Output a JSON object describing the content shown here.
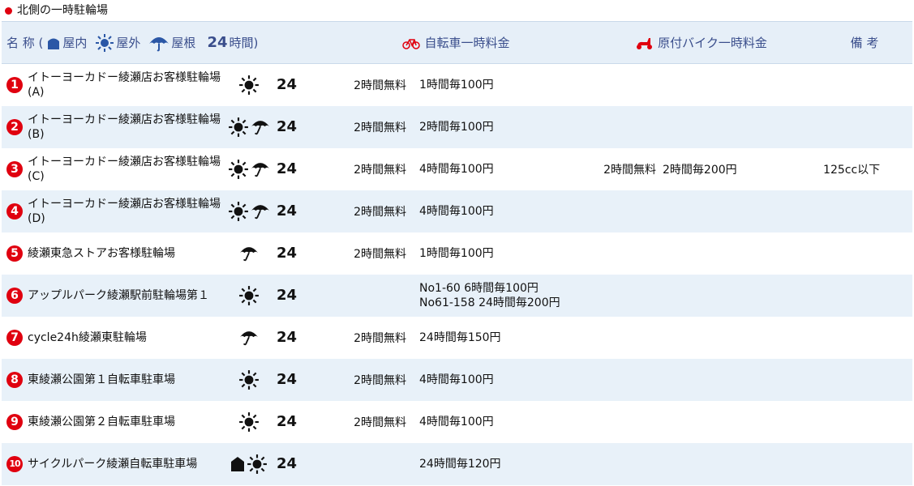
{
  "section": {
    "title": "北側の一時駐輪場"
  },
  "header": {
    "name_label": "名 称 (",
    "indoor_label": "屋内",
    "outdoor_label": "屋外",
    "roof_label": "屋根",
    "h24_number": "24",
    "h24_label": "時間)",
    "bicycle_fee_label": "自転車一時料金",
    "moped_fee_label": "原付バイク一時料金",
    "notes_label": "備 考"
  },
  "rows": [
    {
      "num": "1",
      "name": "イトーヨーカドー綾瀬店お客様駐輪場",
      "name_sub": "(A)",
      "icons": [
        "sun"
      ],
      "hours": "24",
      "bike_free": "2時間無料",
      "bike_fee": "1時間毎100円",
      "bike_fee2": "",
      "moto_free": "",
      "moto_fee": "",
      "notes": ""
    },
    {
      "num": "2",
      "name": "イトーヨーカドー綾瀬店お客様駐輪場",
      "name_sub": "(B)",
      "icons": [
        "sun",
        "umbrella"
      ],
      "hours": "24",
      "bike_free": "2時間無料",
      "bike_fee": "2時間毎100円",
      "bike_fee2": "",
      "moto_free": "",
      "moto_fee": "",
      "notes": ""
    },
    {
      "num": "3",
      "name": "イトーヨーカドー綾瀬店お客様駐輪場",
      "name_sub": "(C)",
      "icons": [
        "sun",
        "umbrella"
      ],
      "hours": "24",
      "bike_free": "2時間無料",
      "bike_fee": "4時間毎100円",
      "bike_fee2": "",
      "moto_free": "2時間無料",
      "moto_fee": "2時間毎200円",
      "notes": "125cc以下"
    },
    {
      "num": "4",
      "name": "イトーヨーカドー綾瀬店お客様駐輪場",
      "name_sub": "(D)",
      "icons": [
        "sun",
        "umbrella"
      ],
      "hours": "24",
      "bike_free": "2時間無料",
      "bike_fee": "4時間毎100円",
      "bike_fee2": "",
      "moto_free": "",
      "moto_fee": "",
      "notes": ""
    },
    {
      "num": "5",
      "name": "綾瀬東急ストアお客様駐輪場",
      "name_sub": "",
      "icons": [
        "umbrella"
      ],
      "hours": "24",
      "bike_free": "2時間無料",
      "bike_fee": "1時間毎100円",
      "bike_fee2": "",
      "moto_free": "",
      "moto_fee": "",
      "notes": ""
    },
    {
      "num": "6",
      "name": "アップルパーク綾瀬駅前駐輪場第１",
      "name_sub": "",
      "icons": [
        "sun"
      ],
      "hours": "24",
      "bike_free": "",
      "bike_fee": "No1-60 6時間毎100円",
      "bike_fee2": "No61-158 24時間毎200円",
      "moto_free": "",
      "moto_fee": "",
      "notes": ""
    },
    {
      "num": "7",
      "name": "cycle24h綾瀬東駐輪場",
      "name_sub": "",
      "icons": [
        "umbrella"
      ],
      "hours": "24",
      "bike_free": "2時間無料",
      "bike_fee": "24時間毎150円",
      "bike_fee2": "",
      "moto_free": "",
      "moto_fee": "",
      "notes": ""
    },
    {
      "num": "8",
      "name": "東綾瀬公園第１自転車駐車場",
      "name_sub": "",
      "icons": [
        "sun"
      ],
      "hours": "24",
      "bike_free": "2時間無料",
      "bike_fee": "4時間毎100円",
      "bike_fee2": "",
      "moto_free": "",
      "moto_fee": "",
      "notes": ""
    },
    {
      "num": "9",
      "name": "東綾瀬公園第２自転車駐車場",
      "name_sub": "",
      "icons": [
        "sun"
      ],
      "hours": "24",
      "bike_free": "2時間無料",
      "bike_fee": "4時間毎100円",
      "bike_fee2": "",
      "moto_free": "",
      "moto_fee": "",
      "notes": ""
    },
    {
      "num": "10",
      "name": "サイクルパーク綾瀬自転車駐車場",
      "name_sub": "",
      "icons": [
        "house",
        "sun"
      ],
      "hours": "24",
      "bike_free": "",
      "bike_fee": "24時間毎120円",
      "bike_fee2": "",
      "moto_free": "",
      "moto_fee": "",
      "notes": ""
    }
  ],
  "colors": {
    "accent_red": "#e0000f",
    "header_bg": "#e6eff8",
    "header_text": "#3a4e8c",
    "row_alt_bg": "#e8f1f9",
    "legend_icon": "#2b57a6"
  }
}
